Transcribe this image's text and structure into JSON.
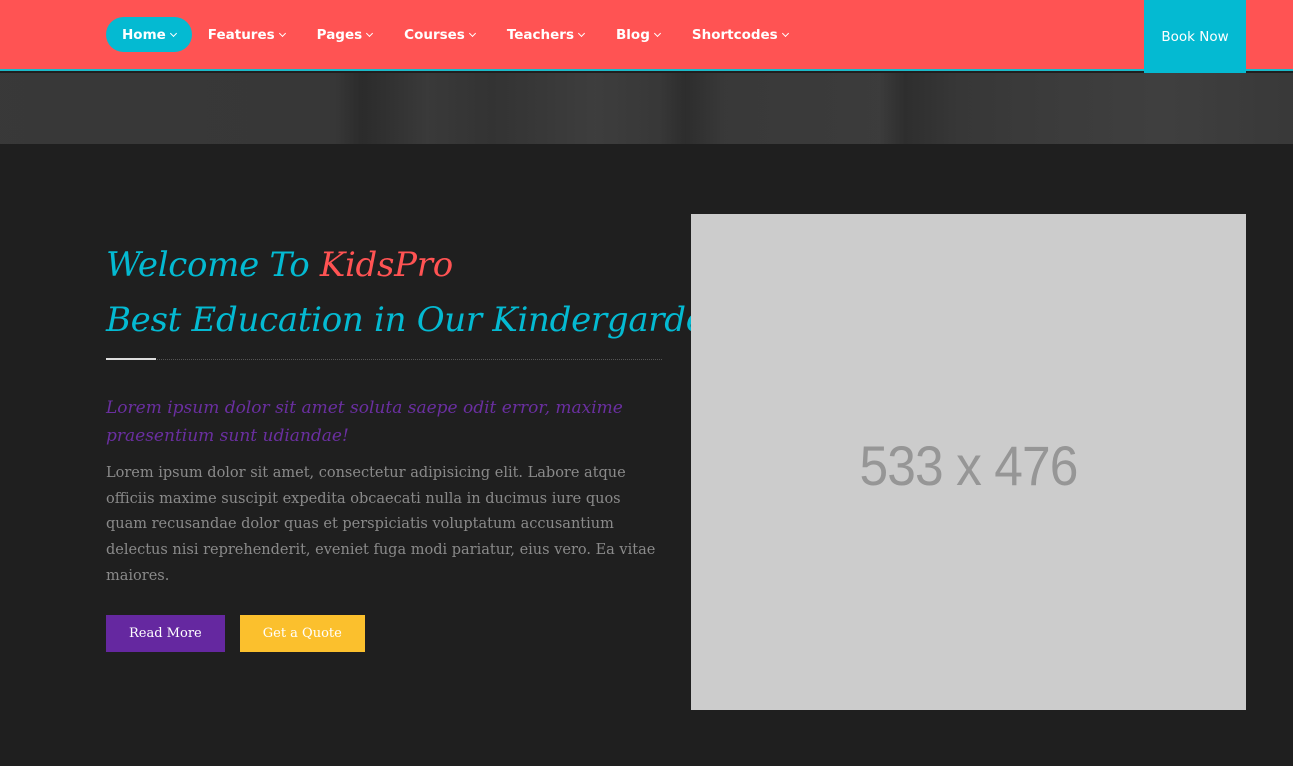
{
  "nav": {
    "items": [
      {
        "label": "Home"
      },
      {
        "label": "Features"
      },
      {
        "label": "Pages"
      },
      {
        "label": "Courses"
      },
      {
        "label": "Teachers"
      },
      {
        "label": "Blog"
      },
      {
        "label": "Shortcodes"
      }
    ],
    "active_item": "Home",
    "book_now": "Book Now"
  },
  "welcome": {
    "title_prefix": "Welcome To",
    "brand": "KidsPro",
    "subtitle": "Best Education in Our Kindergarden",
    "lead": "Lorem ipsum dolor sit amet soluta saepe odit error, maxime praesentium sunt udiandae!",
    "body": "Lorem ipsum dolor sit amet, consectetur adipisicing elit. Labore atque officiis maxime suscipit expedita obcaecati nulla in ducimus iure quos quam recusandae dolor quas et perspiciatis voluptatum accusantium delectus nisi reprehenderit, eveniet fuga modi pariatur, eius vero. Ea vitae maiores.",
    "read_more": "Read More",
    "get_quote": "Get a Quote"
  },
  "image_placeholder": {
    "text": "533 x 476"
  },
  "colors": {
    "nav_bg": "#ff5353",
    "accent_cyan": "#04bad2",
    "brand_red": "#ff5353",
    "purple": "#6528a0",
    "yellow": "#fbc02d",
    "page_bg": "#1f1f1f"
  }
}
